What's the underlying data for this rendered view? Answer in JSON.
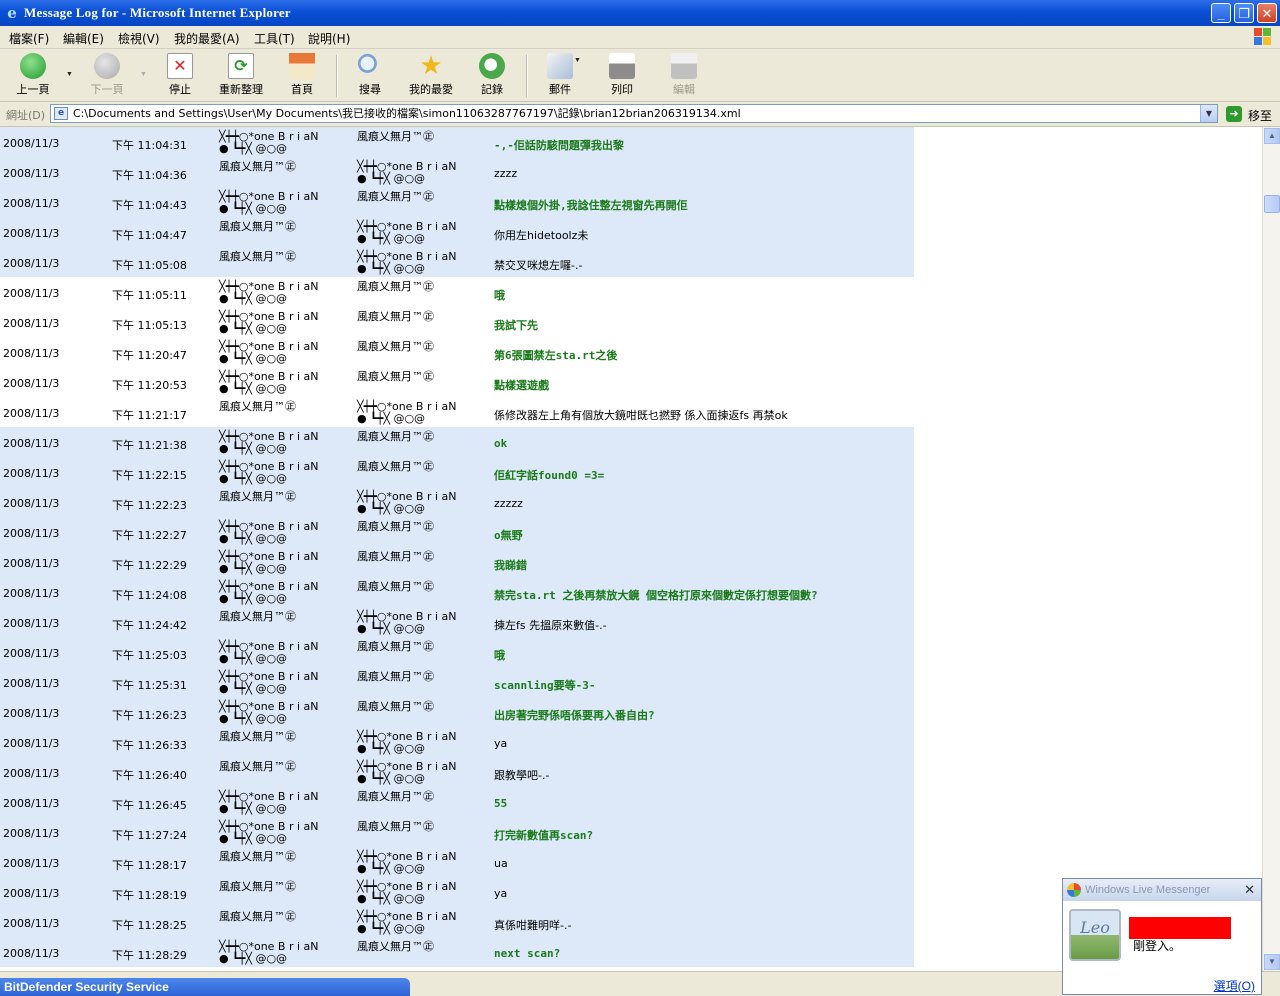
{
  "window": {
    "title": "Message Log for - Microsoft Internet Explorer"
  },
  "menu": [
    "檔案(F)",
    "編輯(E)",
    "檢視(V)",
    "我的最愛(A)",
    "工具(T)",
    "說明(H)"
  ],
  "toolbar": {
    "back": "上一頁",
    "forward": "下一頁",
    "stop": "停止",
    "refresh": "重新整理",
    "home": "首頁",
    "search": "搜尋",
    "favorites": "我的最愛",
    "history": "記錄",
    "mail": "郵件",
    "print": "列印",
    "edit": "編輯"
  },
  "address": {
    "label": "網址(D)",
    "value": "C:\\Documents and Settings\\User\\My Documents\\我已接收的檔案\\simon11063287767197\\記錄\\brian12brian206319134.xml",
    "go": "移至"
  },
  "names": {
    "brian_line1": "╳┿┿○*one B r i aN",
    "brian_line2": "● ┗┿╳ @○@",
    "wind": "風痕乂無月™㊣"
  },
  "rows": [
    {
      "date": "2008/11/3",
      "time": "下午 11:04:31",
      "from_l1": "╳┿┿○*one B r i aN",
      "from_l2": "● ┗┿╳ @○@",
      "to_l1": "風痕乂無月™㊣",
      "to_l2": "",
      "msg": "-,-佢話防駭問題彈我出黎",
      "green": true
    },
    {
      "date": "2008/11/3",
      "time": "下午 11:04:36",
      "from_l1": "風痕乂無月™㊣",
      "from_l2": "",
      "to_l1": "╳┿┿○*one B r i aN",
      "to_l2": "● ┗┿╳ @○@",
      "msg": "zzzz",
      "green": false
    },
    {
      "date": "2008/11/3",
      "time": "下午 11:04:43",
      "from_l1": "╳┿┿○*one B r i aN",
      "from_l2": "● ┗┿╳ @○@",
      "to_l1": "風痕乂無月™㊣",
      "to_l2": "",
      "msg": "點樣熄個外掛,我諗住整左視窗先再開佢",
      "green": true
    },
    {
      "date": "2008/11/3",
      "time": "下午 11:04:47",
      "from_l1": "風痕乂無月™㊣",
      "from_l2": "",
      "to_l1": "╳┿┿○*one B r i aN",
      "to_l2": "● ┗┿╳ @○@",
      "msg": "你用左hidetoolz未",
      "green": false
    },
    {
      "date": "2008/11/3",
      "time": "下午 11:05:08",
      "from_l1": "風痕乂無月™㊣",
      "from_l2": "",
      "to_l1": "╳┿┿○*one B r i aN",
      "to_l2": "● ┗┿╳ @○@",
      "msg": "禁交叉咪熄左囉-.-",
      "green": false
    },
    {
      "date": "2008/11/3",
      "time": "下午 11:05:11",
      "from_l1": "╳┿┿○*one B r i aN",
      "from_l2": "● ┗┿╳ @○@",
      "to_l1": "風痕乂無月™㊣",
      "to_l2": "",
      "msg": "哦",
      "green": true
    },
    {
      "date": "2008/11/3",
      "time": "下午 11:05:13",
      "from_l1": "╳┿┿○*one B r i aN",
      "from_l2": "● ┗┿╳ @○@",
      "to_l1": "風痕乂無月™㊣",
      "to_l2": "",
      "msg": "我試下先",
      "green": true
    },
    {
      "date": "2008/11/3",
      "time": "下午 11:20:47",
      "from_l1": "╳┿┿○*one B r i aN",
      "from_l2": "● ┗┿╳ @○@",
      "to_l1": "風痕乂無月™㊣",
      "to_l2": "",
      "msg": "第6張圖禁左sta.rt之後",
      "green": true
    },
    {
      "date": "2008/11/3",
      "time": "下午 11:20:53",
      "from_l1": "╳┿┿○*one B r i aN",
      "from_l2": "● ┗┿╳ @○@",
      "to_l1": "風痕乂無月™㊣",
      "to_l2": "",
      "msg": "點樣選遊戲",
      "green": true
    },
    {
      "date": "2008/11/3",
      "time": "下午 11:21:17",
      "from_l1": "風痕乂無月™㊣",
      "from_l2": "",
      "to_l1": "╳┿┿○*one B r i aN",
      "to_l2": "● ┗┿╳ @○@",
      "msg": "係修改器左上角有個放大鏡咁既乜撚野 係入面揀返fs 再禁ok",
      "green": false
    },
    {
      "date": "2008/11/3",
      "time": "下午 11:21:38",
      "from_l1": "╳┿┿○*one B r i aN",
      "from_l2": "● ┗┿╳ @○@",
      "to_l1": "風痕乂無月™㊣",
      "to_l2": "",
      "msg": "ok",
      "green": true
    },
    {
      "date": "2008/11/3",
      "time": "下午 11:22:15",
      "from_l1": "╳┿┿○*one B r i aN",
      "from_l2": "● ┗┿╳ @○@",
      "to_l1": "風痕乂無月™㊣",
      "to_l2": "",
      "msg": "佢紅字話found0 =3=",
      "green": true
    },
    {
      "date": "2008/11/3",
      "time": "下午 11:22:23",
      "from_l1": "風痕乂無月™㊣",
      "from_l2": "",
      "to_l1": "╳┿┿○*one B r i aN",
      "to_l2": "● ┗┿╳ @○@",
      "msg": "zzzzz",
      "green": false
    },
    {
      "date": "2008/11/3",
      "time": "下午 11:22:27",
      "from_l1": "╳┿┿○*one B r i aN",
      "from_l2": "● ┗┿╳ @○@",
      "to_l1": "風痕乂無月™㊣",
      "to_l2": "",
      "msg": "o無野",
      "green": true
    },
    {
      "date": "2008/11/3",
      "time": "下午 11:22:29",
      "from_l1": "╳┿┿○*one B r i aN",
      "from_l2": "● ┗┿╳ @○@",
      "to_l1": "風痕乂無月™㊣",
      "to_l2": "",
      "msg": "我睇錯",
      "green": true
    },
    {
      "date": "2008/11/3",
      "time": "下午 11:24:08",
      "from_l1": "╳┿┿○*one B r i aN",
      "from_l2": "● ┗┿╳ @○@",
      "to_l1": "風痕乂無月™㊣",
      "to_l2": "",
      "msg": "禁完sta.rt 之後再禁放大鏡 個空格打原來個數定係打想要個數?",
      "green": true
    },
    {
      "date": "2008/11/3",
      "time": "下午 11:24:42",
      "from_l1": "風痕乂無月™㊣",
      "from_l2": "",
      "to_l1": "╳┿┿○*one B r i aN",
      "to_l2": "● ┗┿╳ @○@",
      "msg": "揀左fs 先搵原來數值-.-",
      "green": false
    },
    {
      "date": "2008/11/3",
      "time": "下午 11:25:03",
      "from_l1": "╳┿┿○*one B r i aN",
      "from_l2": "● ┗┿╳ @○@",
      "to_l1": "風痕乂無月™㊣",
      "to_l2": "",
      "msg": "哦",
      "green": true
    },
    {
      "date": "2008/11/3",
      "time": "下午 11:25:31",
      "from_l1": "╳┿┿○*one B r i aN",
      "from_l2": "● ┗┿╳ @○@",
      "to_l1": "風痕乂無月™㊣",
      "to_l2": "",
      "msg": "scannling要等-3-",
      "green": true
    },
    {
      "date": "2008/11/3",
      "time": "下午 11:26:23",
      "from_l1": "╳┿┿○*one B r i aN",
      "from_l2": "● ┗┿╳ @○@",
      "to_l1": "風痕乂無月™㊣",
      "to_l2": "",
      "msg": "出房著完野係唔係要再入番自由?",
      "green": true
    },
    {
      "date": "2008/11/3",
      "time": "下午 11:26:33",
      "from_l1": "風痕乂無月™㊣",
      "from_l2": "",
      "to_l1": "╳┿┿○*one B r i aN",
      "to_l2": "● ┗┿╳ @○@",
      "msg": "ya",
      "green": false
    },
    {
      "date": "2008/11/3",
      "time": "下午 11:26:40",
      "from_l1": "風痕乂無月™㊣",
      "from_l2": "",
      "to_l1": "╳┿┿○*one B r i aN",
      "to_l2": "● ┗┿╳ @○@",
      "msg": "跟教學吧-.-",
      "green": false
    },
    {
      "date": "2008/11/3",
      "time": "下午 11:26:45",
      "from_l1": "╳┿┿○*one B r i aN",
      "from_l2": "● ┗┿╳ @○@",
      "to_l1": "風痕乂無月™㊣",
      "to_l2": "",
      "msg": "55",
      "green": true
    },
    {
      "date": "2008/11/3",
      "time": "下午 11:27:24",
      "from_l1": "╳┿┿○*one B r i aN",
      "from_l2": "● ┗┿╳ @○@",
      "to_l1": "風痕乂無月™㊣",
      "to_l2": "",
      "msg": "打完新數值再scan?",
      "green": true
    },
    {
      "date": "2008/11/3",
      "time": "下午 11:28:17",
      "from_l1": "風痕乂無月™㊣",
      "from_l2": "",
      "to_l1": "╳┿┿○*one B r i aN",
      "to_l2": "● ┗┿╳ @○@",
      "msg": "ua",
      "green": false
    },
    {
      "date": "2008/11/3",
      "time": "下午 11:28:19",
      "from_l1": "風痕乂無月™㊣",
      "from_l2": "",
      "to_l1": "╳┿┿○*one B r i aN",
      "to_l2": "● ┗┿╳ @○@",
      "msg": "ya",
      "green": false
    },
    {
      "date": "2008/11/3",
      "time": "下午 11:28:25",
      "from_l1": "風痕乂無月™㊣",
      "from_l2": "",
      "to_l1": "╳┿┿○*one B r i aN",
      "to_l2": "● ┗┿╳ @○@",
      "msg": "真係咁難明咩-.-",
      "green": false
    },
    {
      "date": "2008/11/3",
      "time": "下午 11:28:29",
      "from_l1": "╳┿┿○*one B r i aN",
      "from_l2": "● ┗┿╳ @○@",
      "to_l1": "風痕乂無月™㊣",
      "to_l2": "",
      "msg": "next scan?",
      "green": true
    }
  ],
  "row_shading": [
    "blue",
    "blue",
    "blue",
    "blue",
    "blue",
    "white",
    "white",
    "white",
    "white",
    "white",
    "blue",
    "blue",
    "blue",
    "blue",
    "blue",
    "blue",
    "blue",
    "blue",
    "blue",
    "blue",
    "blue",
    "blue",
    "blue",
    "blue",
    "blue",
    "blue",
    "blue",
    "blue"
  ],
  "status": {
    "taskbar_item": "BitDefender Security Service"
  },
  "notification": {
    "title": "Windows Live Messenger",
    "avatar_text": "Leo",
    "message": "剛登入。",
    "options": "選項(O)"
  },
  "colors": {
    "row_blue": "#dde9f8",
    "msg_green": "#1a7a1a",
    "titlebar": "#0a4fd6",
    "redaction": "#ff0000"
  }
}
